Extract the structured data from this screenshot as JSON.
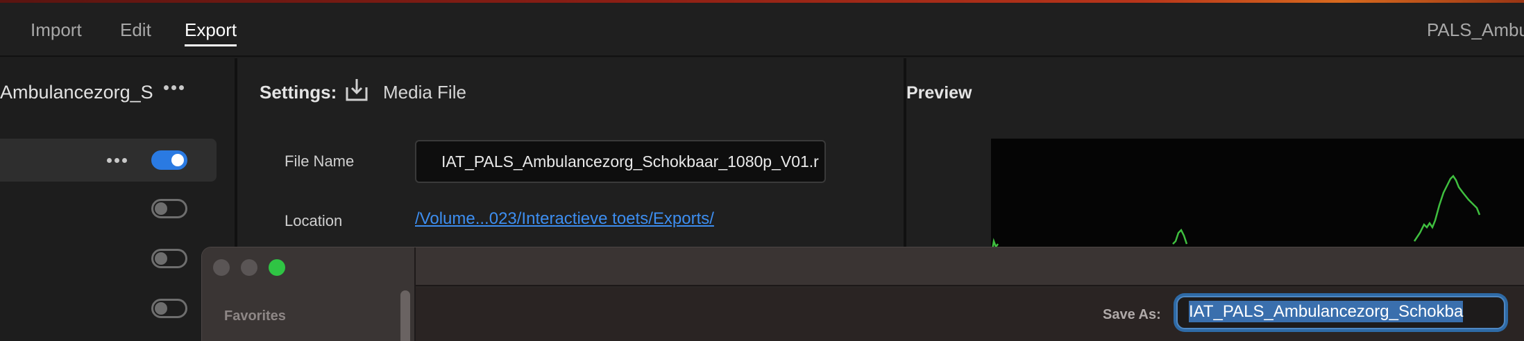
{
  "header": {
    "tabs": [
      {
        "label": "Import",
        "active": false
      },
      {
        "label": "Edit",
        "active": false
      },
      {
        "label": "Export",
        "active": true
      }
    ],
    "project_title": "PALS_Ambu"
  },
  "left_panel": {
    "preset_name": "Ambulancezorg_Sc...",
    "rows": [
      {
        "enabled": true,
        "selected": true
      },
      {
        "enabled": false
      },
      {
        "enabled": false
      },
      {
        "enabled": false
      }
    ]
  },
  "settings": {
    "label": "Settings:",
    "media_label": "Media File",
    "file_name_label": "File Name",
    "file_name_value": "IAT_PALS_Ambulancezorg_Schokbaar_1080p_V01.r",
    "location_label": "Location",
    "location_value": "/Volume...023/Interactieve toets/Exports/"
  },
  "preview": {
    "label": "Preview"
  },
  "save_dialog": {
    "favorites_label": "Favorites",
    "save_as_label": "Save As:",
    "save_as_value": "IAT_PALS_Ambulancezorg_Schokba"
  },
  "colors": {
    "accent": "#2a7ae2",
    "link": "#3d8ef0",
    "waveform": "#3fbf3f",
    "zoom_button": "#2fc444"
  },
  "icons": [
    "more-icon",
    "export-icon",
    "toggle-icon"
  ]
}
